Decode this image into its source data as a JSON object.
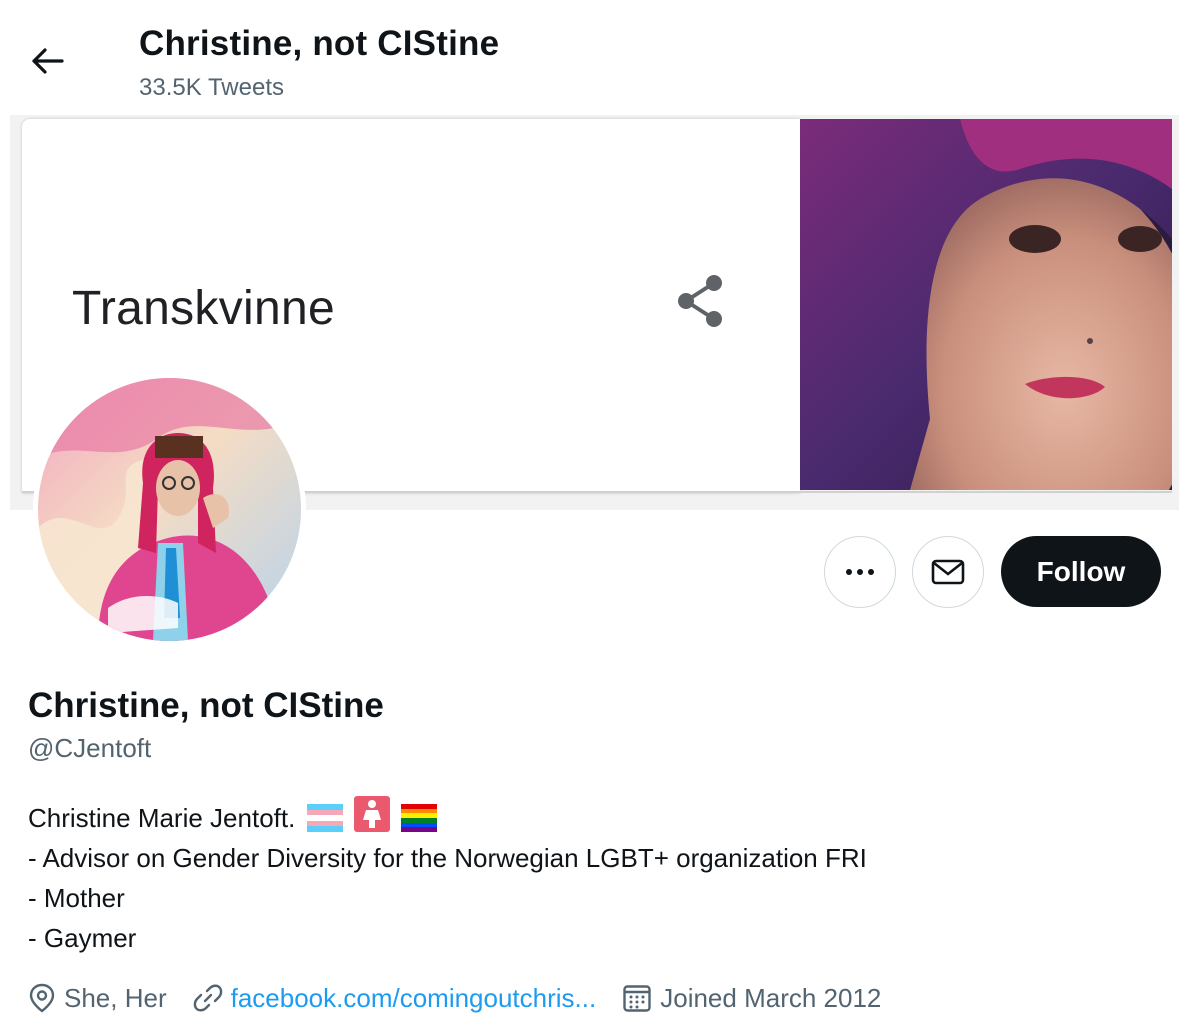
{
  "header": {
    "title": "Christine, not CIStine",
    "tweet_count": "33.5K Tweets",
    "back_icon": "arrow-left-icon"
  },
  "banner": {
    "card_word": "Transkvinne",
    "share_icon": "share-icon"
  },
  "actions": {
    "more_icon": "more-dots-icon",
    "message_icon": "mail-icon",
    "follow_label": "Follow"
  },
  "profile": {
    "display_name": "Christine, not CIStine",
    "handle": "@CJentoft",
    "bio": {
      "line1": "Christine Marie Jentoft.",
      "line1_emojis": [
        "transgender-flag",
        "woman-symbol",
        "rainbow-flag"
      ],
      "line2": "- Advisor on Gender Diversity for the Norwegian LGBT+ organization FRI",
      "line3": "- Mother",
      "line4": "- Gaymer"
    },
    "pronouns": "She, Her",
    "link": "facebook.com/comingoutchris...",
    "joined": "Joined March 2012"
  },
  "colors": {
    "accent": "#1d9bf0",
    "text_primary": "#0f1419",
    "text_secondary": "#536471",
    "follow_bg": "#0f1419"
  }
}
